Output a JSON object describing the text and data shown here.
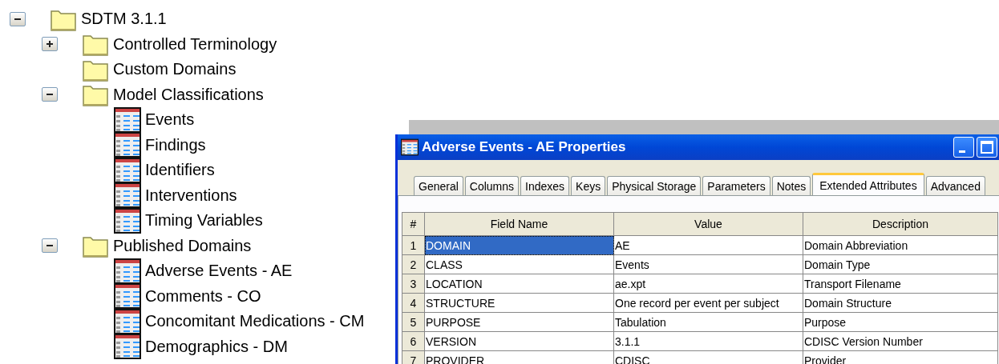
{
  "tree": [
    {
      "label": "SDTM 3.1.1",
      "kind": "folder",
      "expanded": true,
      "children": [
        {
          "label": "Controlled Terminology",
          "kind": "folder",
          "expanded": false
        },
        {
          "label": "Custom Domains",
          "kind": "folder"
        },
        {
          "label": "Model Classifications",
          "kind": "folder",
          "expanded": true,
          "children": [
            {
              "label": "Events",
              "kind": "table"
            },
            {
              "label": "Findings",
              "kind": "table"
            },
            {
              "label": "Identifiers",
              "kind": "table"
            },
            {
              "label": "Interventions",
              "kind": "table"
            },
            {
              "label": "Timing Variables",
              "kind": "table"
            }
          ]
        },
        {
          "label": "Published Domains",
          "kind": "folder",
          "expanded": true,
          "children": [
            {
              "label": "Adverse Events - AE",
              "kind": "table"
            },
            {
              "label": "Comments - CO",
              "kind": "table"
            },
            {
              "label": "Concomitant Medications - CM",
              "kind": "table"
            },
            {
              "label": "Demographics - DM",
              "kind": "table"
            }
          ]
        }
      ]
    }
  ],
  "window": {
    "title": "Adverse Events - AE Properties"
  },
  "tabs": [
    {
      "label": "General",
      "selected": false
    },
    {
      "label": "Columns",
      "selected": false
    },
    {
      "label": "Indexes",
      "selected": false
    },
    {
      "label": "Keys",
      "selected": false
    },
    {
      "label": "Physical Storage",
      "selected": false
    },
    {
      "label": "Parameters",
      "selected": false
    },
    {
      "label": "Notes",
      "selected": false
    },
    {
      "label": "Extended Attributes",
      "selected": true
    },
    {
      "label": "Advanced",
      "selected": false
    }
  ],
  "table": {
    "columns": [
      "#",
      "Field Name",
      "Value",
      "Description"
    ],
    "rows": [
      {
        "number": "1",
        "field_name": "DOMAIN",
        "value": "AE",
        "description": "Domain Abbreviation",
        "selected": true
      },
      {
        "number": "2",
        "field_name": "CLASS",
        "value": "Events",
        "description": "Domain Type",
        "selected": false
      },
      {
        "number": "3",
        "field_name": "LOCATION",
        "value": "ae.xpt",
        "description": "Transport Filename",
        "selected": false
      },
      {
        "number": "4",
        "field_name": "STRUCTURE",
        "value": "One record per event per subject",
        "description": "Domain Structure",
        "selected": false
      },
      {
        "number": "5",
        "field_name": "PURPOSE",
        "value": "Tabulation",
        "description": "Purpose",
        "selected": false
      },
      {
        "number": "6",
        "field_name": "VERSION",
        "value": "3.1.1",
        "description": "CDISC Version Number",
        "selected": false
      },
      {
        "number": "7",
        "field_name": "PROVIDER",
        "value": "CDISC",
        "description": "Provider",
        "selected": false
      }
    ]
  }
}
